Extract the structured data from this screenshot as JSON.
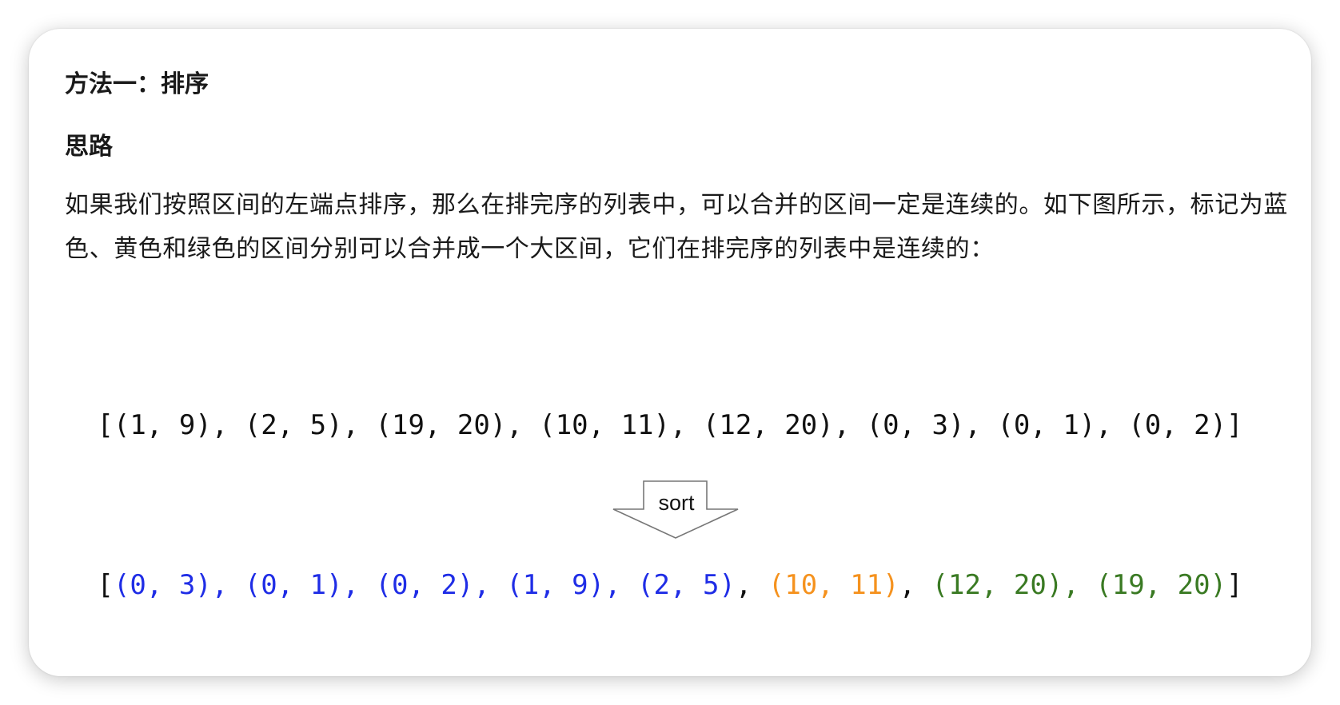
{
  "heading": "方法一：排序",
  "subheading": "思路",
  "paragraph": "如果我们按照区间的左端点排序，那么在排完序的列表中，可以合并的区间一定是连续的。如下图所示，标记为蓝色、黄色和绿色的区间分别可以合并成一个大区间，它们在排完序的列表中是连续的：",
  "figure": {
    "before": {
      "open": "[",
      "close": "]",
      "separator": ", ",
      "items": [
        "(1, 9)",
        "(2, 5)",
        "(19, 20)",
        "(10, 11)",
        "(12, 20)",
        "(0, 3)",
        "(0, 1)",
        "(0, 2)"
      ]
    },
    "arrow_label": "sort",
    "after": {
      "open": "[",
      "close": "]",
      "separator": ", ",
      "items": [
        {
          "text": "(0, 3)",
          "group": "blue"
        },
        {
          "text": "(0, 1)",
          "group": "blue"
        },
        {
          "text": "(0, 2)",
          "group": "blue"
        },
        {
          "text": "(1, 9)",
          "group": "blue"
        },
        {
          "text": "(2, 5)",
          "group": "blue"
        },
        {
          "text": "(10, 11)",
          "group": "orange"
        },
        {
          "text": "(12, 20)",
          "group": "green"
        },
        {
          "text": "(19, 20)",
          "group": "green"
        }
      ]
    }
  },
  "colors": {
    "blue": "#1f2de6",
    "orange": "#f5921e",
    "green": "#3a7a23",
    "bracket": "#111111"
  }
}
